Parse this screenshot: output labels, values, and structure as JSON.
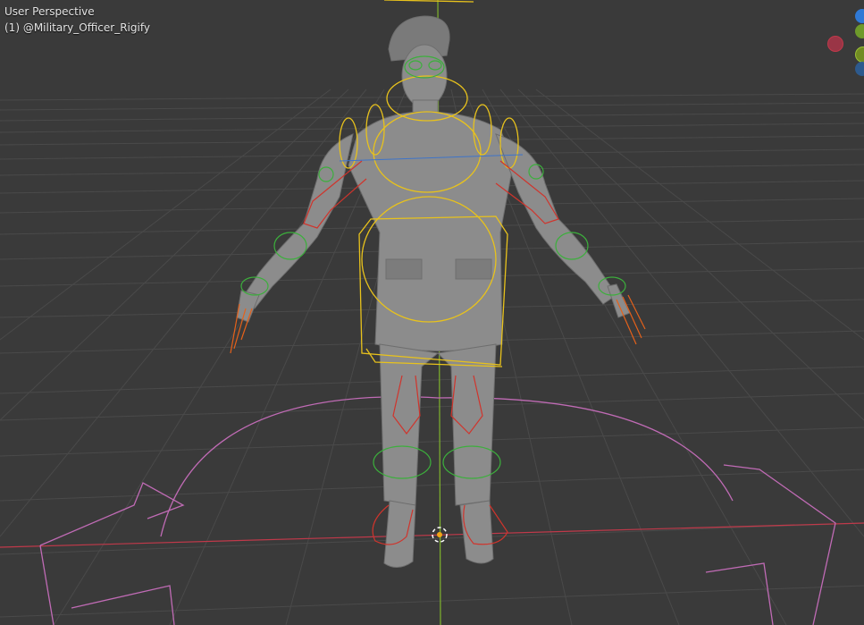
{
  "viewport": {
    "view_name": "User Perspective",
    "object_label": "(1) @Military_Officer_Rigify"
  },
  "colors": {
    "background": "#3a3a3a",
    "grid": "#4a4a4a",
    "axis_x": "#c0394a",
    "axis_y": "#7fb32c",
    "bone_fk_yellow": "#e8c21c",
    "bone_ik_red": "#d0342c",
    "bone_tweak_green": "#3caf3c",
    "bone_root_pink": "#c06bb5",
    "model_gray": "#8c8c8c"
  },
  "gizmo": {
    "icons": [
      "axis-z-icon",
      "axis-y-icon",
      "axis-x-neg-icon",
      "axis-x-icon",
      "axis-y-neg-icon"
    ]
  }
}
